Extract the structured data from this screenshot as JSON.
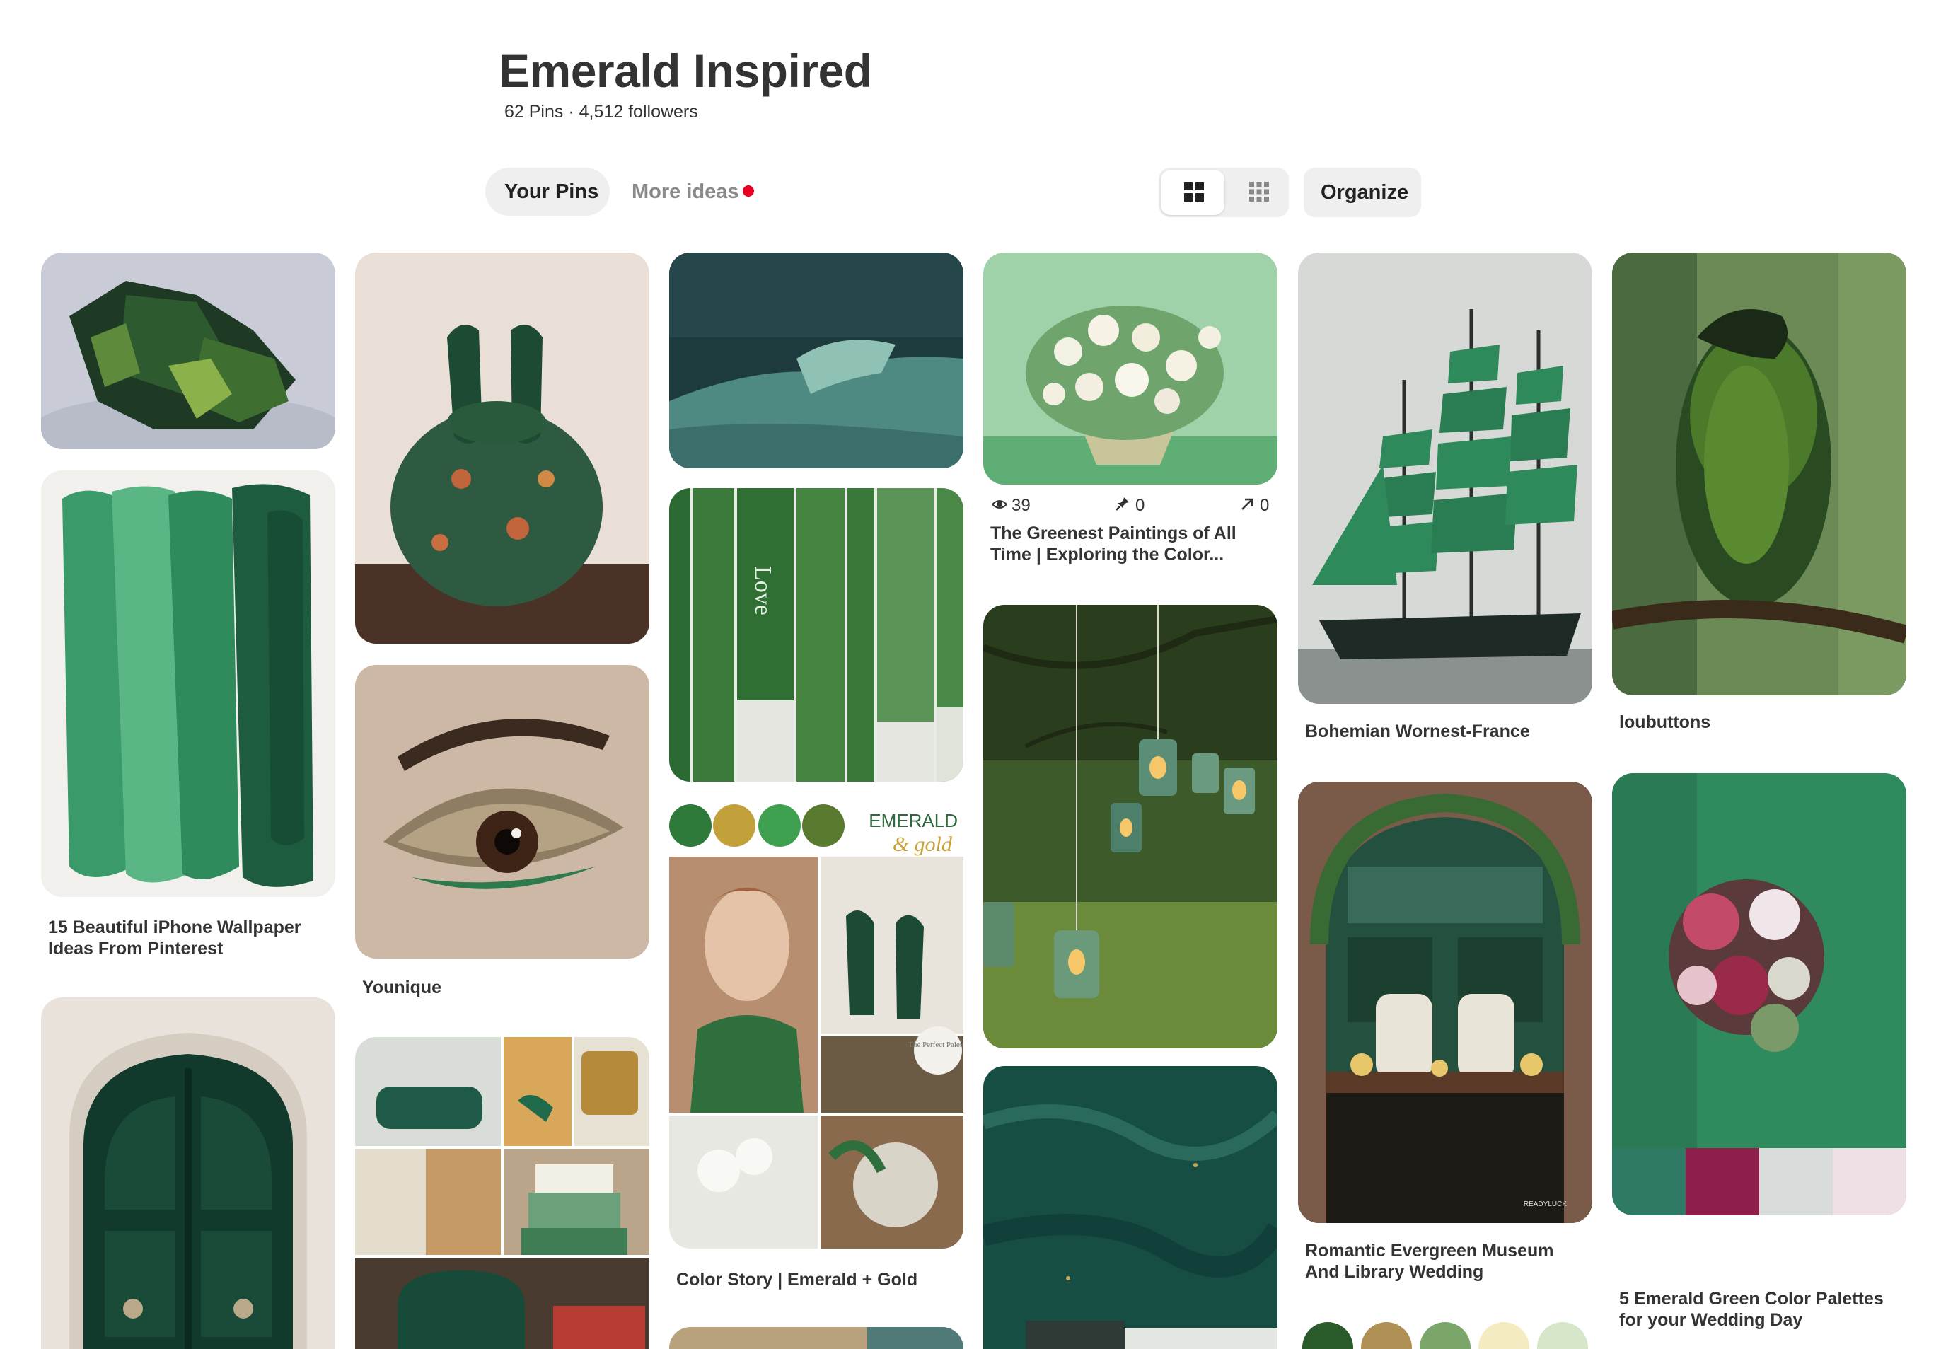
{
  "board": {
    "title": "Emerald Inspired",
    "subtitle": "62 Pins · 4,512 followers"
  },
  "tabs": [
    {
      "label": "Your Pins",
      "active": true
    },
    {
      "label": "More ideas",
      "has_notification": true
    }
  ],
  "toolbar": {
    "organize_label": "Organize",
    "view_options": [
      "grid-large-icon",
      "grid-small-icon"
    ]
  },
  "captions": {
    "iphone_wallpaper": "15 Beautiful iPhone Wallpaper Ideas From Pinterest",
    "younique": "Younique",
    "color_story": "Color Story | Emerald + Gold",
    "greenest_paintings": "The Greenest Paintings of All Time | Exploring the Color...",
    "bohemian": "Bohemian Wornest-France",
    "loubuttons": "loubuttons",
    "romantic_wedding": "Romantic Evergreen Museum And Library Wedding",
    "palettes": "5 Emerald Green Color Palettes for your Wedding Day"
  },
  "painting_stats": {
    "views": "39",
    "saves": "0",
    "clicks": "0"
  },
  "image_text": {
    "emerald_word": "EMERALD",
    "gold_word": "& gold",
    "books_love": "Love",
    "perfect_palette": "The Perfect Palette",
    "readyluck": "READYLUCK"
  },
  "colors": {
    "accent": "#e60023",
    "emerald": "#2a7a4f",
    "palette_teal": "#2f7a64",
    "palette_berry": "#8e1f4c",
    "palette_grey": "#d8dcdb",
    "palette_blush": "#efe0e6"
  }
}
